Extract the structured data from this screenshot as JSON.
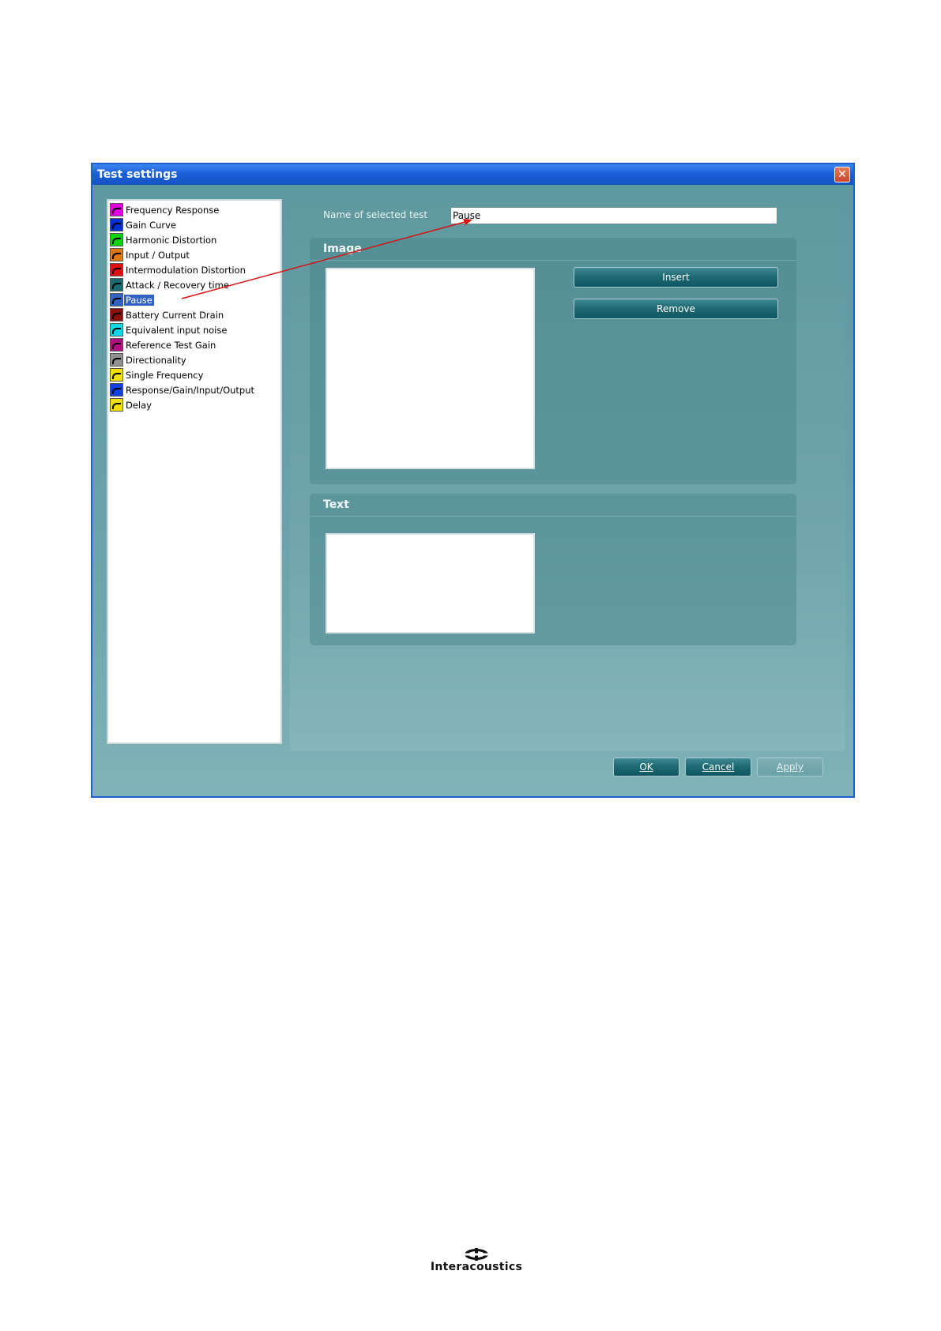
{
  "window": {
    "title": "Test settings",
    "close_glyph": "✕"
  },
  "test_list": {
    "items": [
      {
        "label": "Frequency Response",
        "icon": "frequency-response-icon",
        "color": "#e000e0",
        "selected": false
      },
      {
        "label": "Gain Curve",
        "icon": "gain-curve-icon",
        "color": "#0030d0",
        "selected": false
      },
      {
        "label": "Harmonic Distortion",
        "icon": "harmonic-distortion-icon",
        "color": "#10d010",
        "selected": false
      },
      {
        "label": "Input / Output",
        "icon": "input-output-icon",
        "color": "#e07810",
        "selected": false
      },
      {
        "label": "Intermodulation Distortion",
        "icon": "intermodulation-distortion-icon",
        "color": "#e01010",
        "selected": false
      },
      {
        "label": "Attack / Recovery time",
        "icon": "attack-recovery-icon",
        "color": "#1a6a70",
        "selected": false
      },
      {
        "label": "Pause",
        "icon": "pause-icon",
        "color": "#3163c5",
        "selected": true
      },
      {
        "label": "Battery Current Drain",
        "icon": "battery-icon",
        "color": "#8a1010",
        "selected": false
      },
      {
        "label": "Equivalent input noise",
        "icon": "noise-icon",
        "color": "#10d8e8",
        "selected": false
      },
      {
        "label": "Reference Test Gain",
        "icon": "reference-gain-icon",
        "color": "#b01080",
        "selected": false
      },
      {
        "label": "Directionality",
        "icon": "directionality-icon",
        "color": "#909090",
        "selected": false
      },
      {
        "label": "Single Frequency",
        "icon": "single-frequency-icon",
        "color": "#f0e000",
        "selected": false
      },
      {
        "label": "Response/Gain/Input/Output",
        "icon": "response-gain-icon",
        "color": "#1040e0",
        "selected": false
      },
      {
        "label": "Delay",
        "icon": "delay-icon",
        "color": "#f0e000",
        "selected": false
      }
    ]
  },
  "settings": {
    "name_label": "Name of selected test",
    "name_value": "Pause",
    "image_header": "Image",
    "text_header": "Text",
    "insert_label": "Insert",
    "remove_label": "Remove"
  },
  "buttons": {
    "ok": "OK",
    "cancel": "Cancel",
    "apply": "Apply"
  },
  "logo": {
    "text": "Interacoustics"
  }
}
